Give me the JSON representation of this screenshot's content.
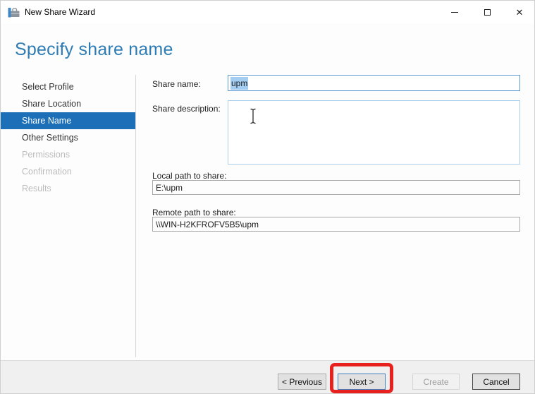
{
  "window": {
    "title": "New Share Wizard",
    "icons": {
      "app": "share-wizard",
      "minimize": "minimize-line",
      "maximize": "maximize-box",
      "close": "✕"
    }
  },
  "page": {
    "title": "Specify share name"
  },
  "sidebar": {
    "items": [
      {
        "label": "Select Profile",
        "state": "enabled"
      },
      {
        "label": "Share Location",
        "state": "enabled"
      },
      {
        "label": "Share Name",
        "state": "selected"
      },
      {
        "label": "Other Settings",
        "state": "enabled"
      },
      {
        "label": "Permissions",
        "state": "disabled"
      },
      {
        "label": "Confirmation",
        "state": "disabled"
      },
      {
        "label": "Results",
        "state": "disabled"
      }
    ]
  },
  "form": {
    "share_name": {
      "label": "Share name:",
      "value": "upm",
      "selection": "highlighted"
    },
    "share_description": {
      "label": "Share description:",
      "value": ""
    },
    "local_path": {
      "label": "Local path to share:",
      "value": "E:\\upm"
    },
    "remote_path": {
      "label": "Remote path to share:",
      "value": "\\\\WIN-H2KFROFV5B5\\upm"
    }
  },
  "footer": {
    "buttons": [
      {
        "label": "< Previous",
        "state": "enabled"
      },
      {
        "label": "Next >",
        "state": "default"
      },
      {
        "label": "Create",
        "state": "disabled"
      },
      {
        "label": "Cancel",
        "state": "enabled"
      }
    ]
  },
  "annotation": {
    "type": "highlight-box",
    "target": "next-button",
    "color": "#e9211e"
  },
  "colors": {
    "accent_blue": "#1d70b8",
    "title_blue": "#2d7cb5",
    "selection_blue": "#a3cdf1",
    "focused_border_blue": "#5b9ad0",
    "annotation_red": "#e9211e",
    "footer_gray": "#f0f0f0"
  }
}
